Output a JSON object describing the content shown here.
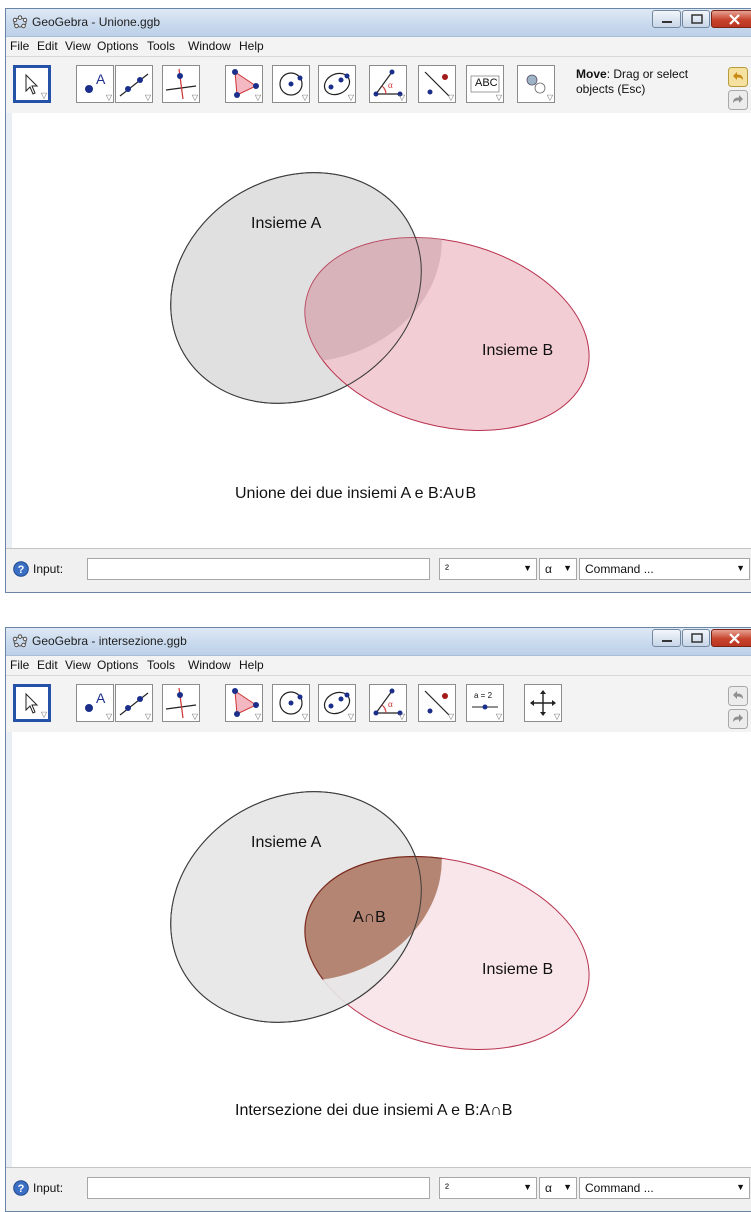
{
  "windows": [
    {
      "title": "GeoGebra - Unione.ggb",
      "menu": [
        "File",
        "Edit",
        "View",
        "Options",
        "Tools",
        "Window",
        "Help"
      ],
      "toolbar": {
        "abc_label": "ABC",
        "help_title": "Move",
        "help_text": ": Drag or select",
        "help_text2": "objects (Esc)"
      },
      "canvas": {
        "label_a": "Insieme A",
        "label_b": "Insieme B",
        "caption": "Unione dei due insiemi A e B:A∪B"
      },
      "inputbar": {
        "input_label": "Input:",
        "input_value": "",
        "combo_symbols": "²",
        "combo_greek": "α",
        "combo_command": "Command ..."
      }
    },
    {
      "title": "GeoGebra - intersezione.ggb",
      "menu": [
        "File",
        "Edit",
        "View",
        "Options",
        "Tools",
        "Window",
        "Help"
      ],
      "toolbar": {
        "slider_label": "a = 2"
      },
      "canvas": {
        "label_a": "Insieme A",
        "label_b": "Insieme B",
        "label_intersection": "A∩B",
        "caption": "Intersezione dei due insiemi A e B:A∩B"
      },
      "inputbar": {
        "input_label": "Input:",
        "input_value": "",
        "combo_symbols": "²",
        "combo_greek": "α",
        "combo_command": "Command ..."
      }
    }
  ],
  "colors": {
    "set_a_fill": "#e0e0e0",
    "set_a_stroke": "#3c3c3c",
    "set_b_fill": "#f0c4cd",
    "set_b_stroke": "#b8324e",
    "union_overlap": "#d6aab2",
    "intersection_fill": "#b58573",
    "intersection_stroke": "#7a2a1e",
    "set_b_light_fill": "#f9e6ea",
    "selected_tool_border": "#2651a8"
  }
}
